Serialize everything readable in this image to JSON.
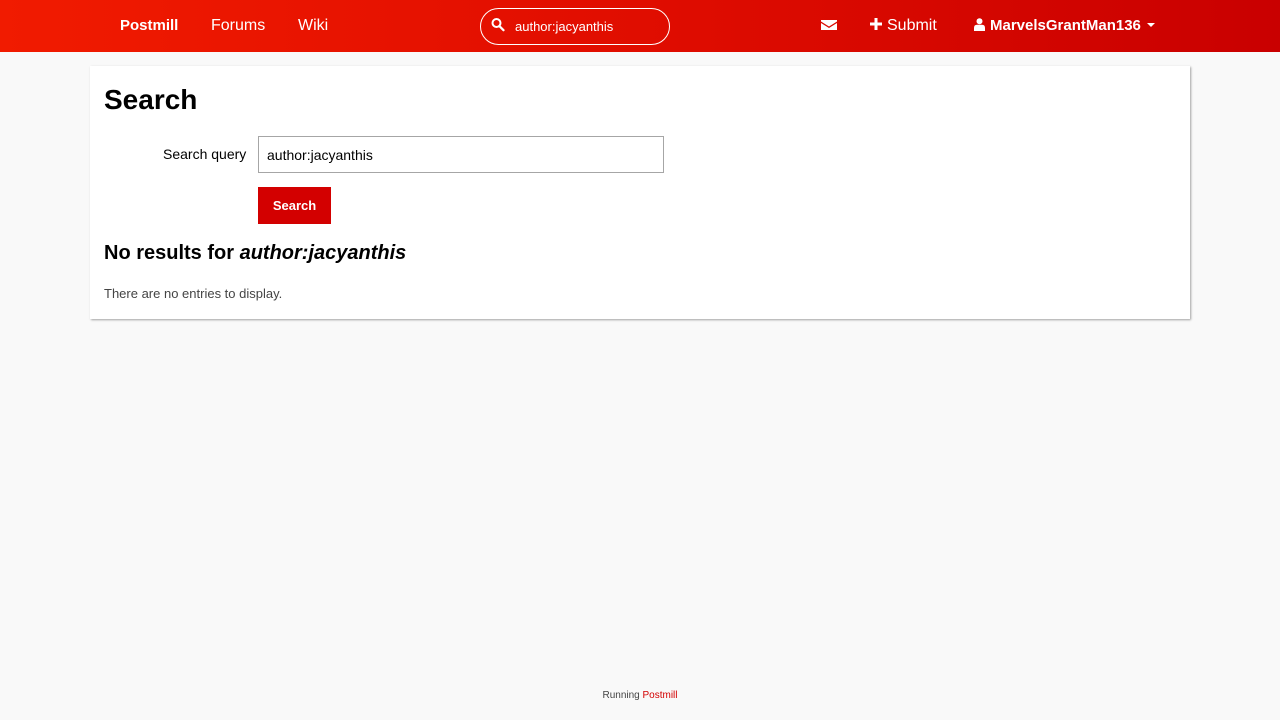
{
  "nav": {
    "brand": "Postmill",
    "forums": "Forums",
    "wiki": "Wiki",
    "search_value": "author:jacyanthis",
    "submit": "Submit",
    "username": "MarvelsGrantMan136"
  },
  "icons": {
    "search": "search-icon",
    "messages": "envelope-icon",
    "submit": "plus-icon",
    "user": "user-icon",
    "dropdown": "caret-down-icon"
  },
  "colors": {
    "accent": "#d30000",
    "topbar_start": "#f11b00",
    "topbar_end": "#c90000"
  },
  "main": {
    "title": "Search",
    "query_label": "Search query",
    "query_value": "author:jacyanthis",
    "search_button": "Search",
    "results_prefix": "No results for ",
    "results_query": "author:jacyanthis",
    "empty_message": "There are no entries to display."
  },
  "footer": {
    "prefix": "Running ",
    "link": "Postmill"
  }
}
